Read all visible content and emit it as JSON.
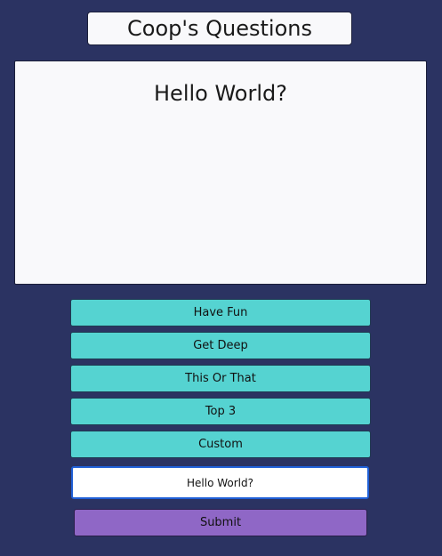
{
  "header": {
    "title": "Coop's Questions"
  },
  "question": {
    "text": "Hello World?"
  },
  "categories": [
    {
      "label": "Have Fun"
    },
    {
      "label": "Get Deep"
    },
    {
      "label": "This Or That"
    },
    {
      "label": "Top 3"
    },
    {
      "label": "Custom"
    }
  ],
  "custom_input": {
    "value": "Hello World?",
    "placeholder": ""
  },
  "submit": {
    "label": "Submit"
  },
  "colors": {
    "background": "#2b3362",
    "category_button": "#55d3d1",
    "submit_button": "#8f67c6",
    "card": "#f9f9fb",
    "input_focus_border": "#1f5fd6"
  }
}
